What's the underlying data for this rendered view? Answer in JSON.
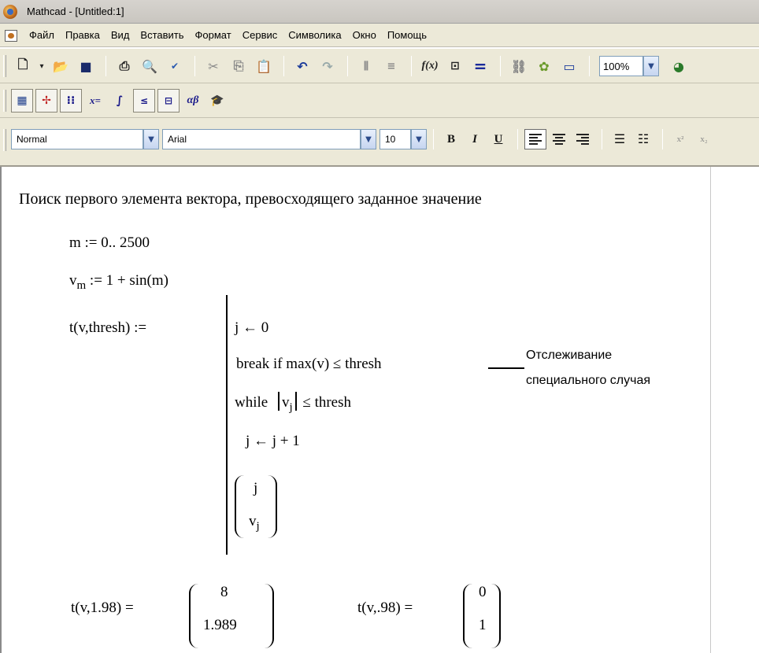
{
  "window": {
    "title": "Mathcad - [Untitled:1]"
  },
  "menu": [
    "Файл",
    "Правка",
    "Вид",
    "Вставить",
    "Формат",
    "Сервис",
    "Символика",
    "Окно",
    "Помощь"
  ],
  "toolbar_standard": {
    "zoom": "100%"
  },
  "toolbar_format": {
    "style": "Normal",
    "font": "Arial",
    "size": "10",
    "bold_label": "B",
    "italic_label": "I",
    "underline_label": "U"
  },
  "worksheet": {
    "heading": "Поиск первого элемента вектора, превосходящего заданное значение",
    "range_def": "m := 0.. 2500",
    "vec_name": "v",
    "vec_sub": "m",
    "vec_rhs": " := 1 + sin(m)",
    "func_def": "t(v,thresh) :=",
    "prog_line1": "j ← 0",
    "prog_line2": "break  if  max(v) ≤ thresh",
    "prog_line3_kw": "while",
    "prog_line3_v": "v",
    "prog_line3_sub": "j",
    "prog_line3_rhs": "≤ thresh",
    "prog_line4": "j ← j + 1",
    "prog_ret_top": "j",
    "prog_ret_bot_v": "v",
    "prog_ret_bot_sub": "j",
    "annotation_line1": "Отслеживание",
    "annotation_line2": "специального случая",
    "eval1_lhs": "t(v,1.98) =",
    "eval1_top": "8",
    "eval1_bot": "1.989",
    "eval2_lhs": "t(v,.98) =",
    "eval2_top": "0",
    "eval2_bot": "1"
  }
}
